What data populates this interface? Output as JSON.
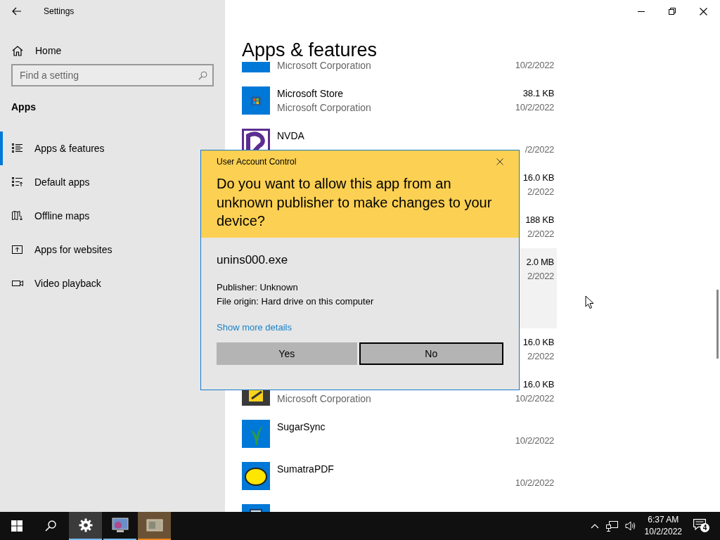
{
  "window": {
    "title": "Settings"
  },
  "sidebar": {
    "home": "Home",
    "search": {
      "placeholder": "Find a setting"
    },
    "section": "Apps",
    "items": [
      {
        "label": "Apps & features",
        "selected": true
      },
      {
        "label": "Default apps",
        "selected": false
      },
      {
        "label": "Offline maps",
        "selected": false
      },
      {
        "label": "Apps for websites",
        "selected": false
      },
      {
        "label": "Video playback",
        "selected": false
      }
    ]
  },
  "page": {
    "title": "Apps & features",
    "apps": [
      {
        "kind": "blue",
        "publisher": "Microsoft Corporation",
        "date": "10/2/2022",
        "selected": false
      },
      {
        "kind": "store",
        "name": "Microsoft Store",
        "publisher": "Microsoft Corporation",
        "size": "38.1 KB",
        "date": "10/2/2022",
        "selected": false
      },
      {
        "kind": "nvda",
        "name": "NVDA",
        "date": "/2/2022",
        "selected": false
      },
      {
        "size": "16.0 KB",
        "date": "2/2022",
        "selected": false
      },
      {
        "size": "188 KB",
        "date": "2/2022",
        "selected": false
      },
      {
        "size": "2.0 MB",
        "date": "2/2022",
        "selected": true
      },
      {
        "size": "16.0 KB",
        "date": "2/2022",
        "selected": false
      },
      {
        "kind": "notes",
        "publisher": "Microsoft Corporation",
        "size": "16.0 KB",
        "date": "10/2/2022",
        "selected": false
      },
      {
        "kind": "sugarsync",
        "name": "SugarSync",
        "date": "10/2/2022",
        "selected": false
      },
      {
        "kind": "pdf",
        "name": "SumatraPDF",
        "date": "10/2/2022",
        "selected": false
      },
      {
        "kind": "teracopy",
        "selected": false
      }
    ]
  },
  "dialog": {
    "title": "User Account Control",
    "question": "Do you want to allow this app from an unknown publisher to make changes to your device?",
    "program": "unins000.exe",
    "details": [
      "Publisher: Unknown",
      "File origin: Hard drive on this computer"
    ],
    "link": "Show more details",
    "buttons": [
      {
        "label": "Yes",
        "focused": false
      },
      {
        "label": "No",
        "focused": true
      }
    ]
  },
  "taskbar": {
    "apps": [
      {
        "kind": "gear",
        "active": true,
        "flashing": false
      },
      {
        "kind": "picture-app",
        "active": false,
        "flashing": false
      },
      {
        "kind": "window-app",
        "active": false,
        "flashing": true
      }
    ],
    "time": "6:37 AM",
    "date": "10/2/2022",
    "notifications": "4"
  }
}
